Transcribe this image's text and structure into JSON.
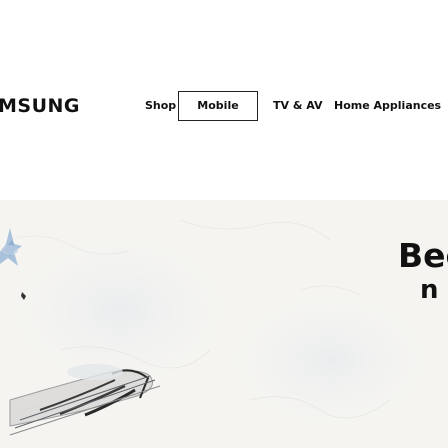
{
  "header": {
    "logo_text": "MSUNG",
    "nav": {
      "shop": "Shop",
      "mobile": "Mobile",
      "tv_av": "TV & AV",
      "home_appliances": "Home Appliances"
    }
  },
  "hero": {
    "title": "Bec",
    "subtitle": "n"
  },
  "colors": {
    "background": "#ffffff",
    "hero_background": "#f6f5f2",
    "text": "#111111",
    "accent_blue": "#8fb3d9"
  }
}
